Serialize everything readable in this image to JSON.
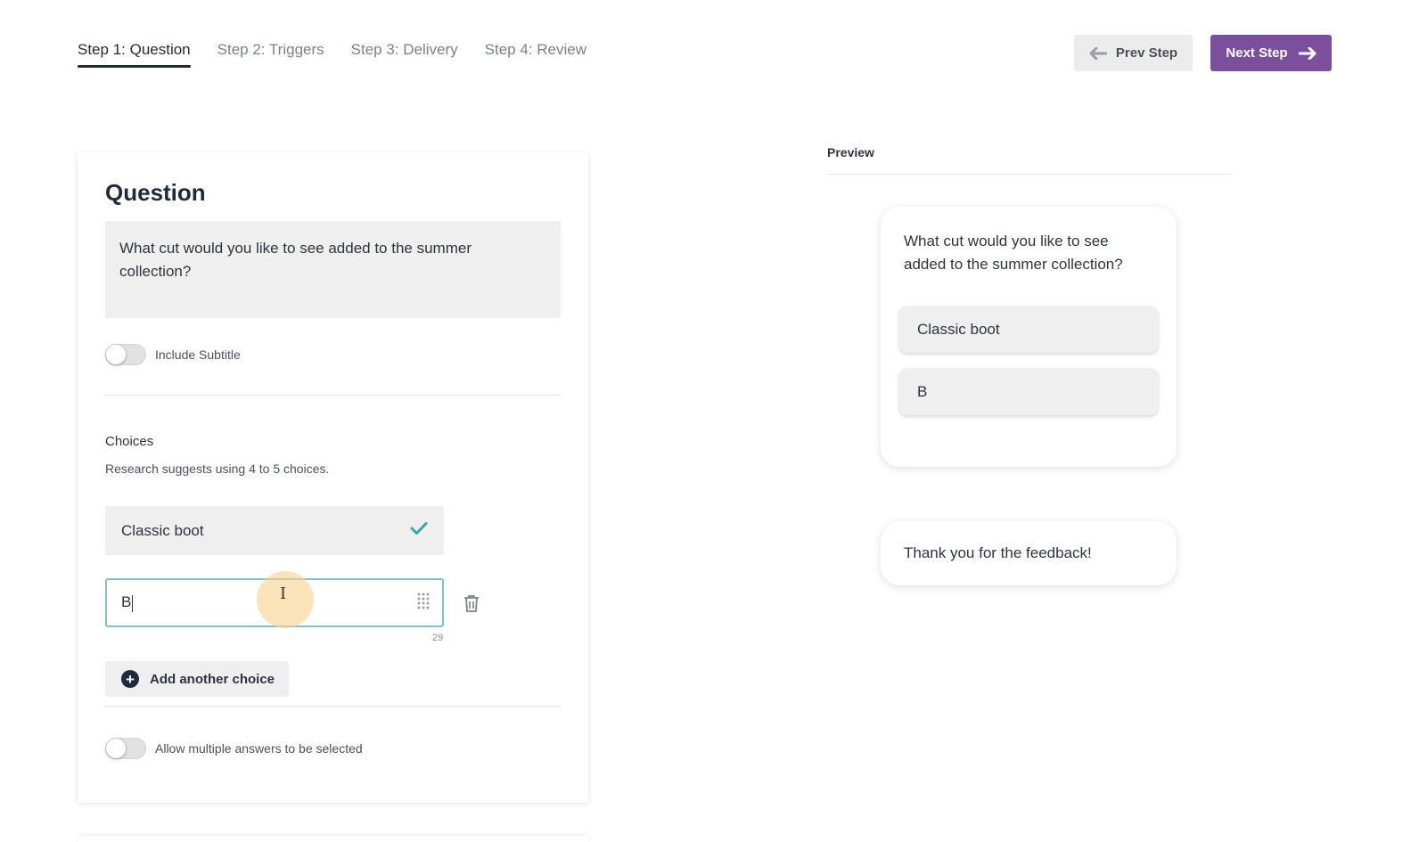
{
  "tabs": [
    {
      "label": "Step 1: Question",
      "active": true
    },
    {
      "label": "Step 2: Triggers",
      "active": false
    },
    {
      "label": "Step 3: Delivery",
      "active": false
    },
    {
      "label": "Step 4: Review",
      "active": false
    }
  ],
  "nav": {
    "prev_label": "Prev Step",
    "next_label": "Next Step"
  },
  "editor": {
    "title": "Question",
    "question_text": "What cut would you like to see added to the summer collection?",
    "subtitle_toggle": {
      "label": "Include Subtitle",
      "on": false
    },
    "choices_label": "Choices",
    "choices_hint": "Research suggests using 4 to 5 choices.",
    "choices": [
      {
        "value": "Classic boot",
        "confirmed": true
      },
      {
        "value": "B",
        "editing": true,
        "remaining_chars": "29"
      }
    ],
    "add_choice_label": "Add another choice",
    "multiple_toggle": {
      "label": "Allow multiple answers to be selected",
      "on": false
    }
  },
  "preview": {
    "label": "Preview",
    "question_text": "What cut would you like to see added to the summer collection?",
    "choices": [
      "Classic boot",
      "B"
    ],
    "thank_you": "Thank you for the feedback!"
  },
  "colors": {
    "accent_purple": "#7c4f9c",
    "focus_teal": "#7fc1c9",
    "check_teal": "#3aa6a6",
    "text_dark": "#1f2a3a"
  },
  "icons": {
    "prev": "arrow-left-icon",
    "next": "arrow-right-icon",
    "confirm": "checkmark-icon",
    "drag": "drag-handle-icon",
    "delete": "trash-icon",
    "add": "plus-circle-icon"
  }
}
